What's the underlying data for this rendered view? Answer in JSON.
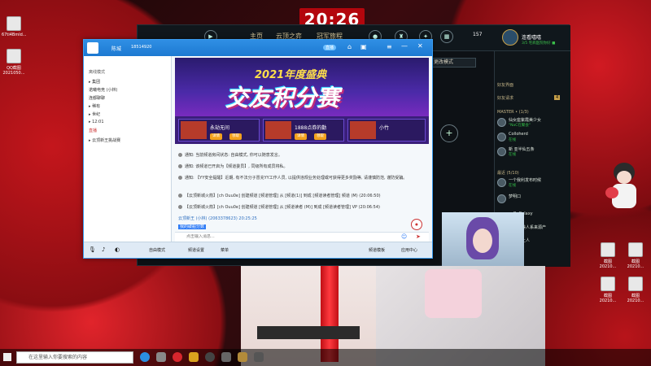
{
  "desktop": {
    "icons": [
      {
        "label": "67ti4Bmld..."
      },
      {
        "label": "QQ截图 2021050..."
      },
      {
        "label": "截图 20210..."
      },
      {
        "label": "截图 20210..."
      },
      {
        "label": "截图 20210..."
      },
      {
        "label": "截图 20210..."
      }
    ],
    "clock": "20:26"
  },
  "game": {
    "nav": [
      "主页",
      "云顶之弈",
      "冠军旅程"
    ],
    "currency": "157",
    "mode_select": "更改模式",
    "profile_name": "连看嘻嘻",
    "profile_status": "3/5 宅病医院你好 ■",
    "level": "574",
    "friend_panel_title": "好友界面",
    "requests_label": "好友请求",
    "requests_count": "4",
    "master_group": "MASTER • (1/3)",
    "recent_group": "最近 (5/10)",
    "friends": [
      {
        "name": "仙女座紫霞美少女",
        "status": "\"NaC在聚会\""
      },
      {
        "name": "Colloherd",
        "status": "在线"
      },
      {
        "name": "新 亚半仙五条",
        "status": "在线"
      },
      {
        "name": "一个我利发布时候",
        "status": "在线"
      },
      {
        "name": "梦明口",
        "status": ""
      },
      {
        "name": "ReGalaxy",
        "status": ""
      },
      {
        "name": "阿那美人系来源产",
        "status": ""
      },
      {
        "name": "冥天上人",
        "status": ""
      }
    ],
    "online_button": "在线模式"
  },
  "qq": {
    "title_name": "陈城",
    "title_id": "18514920",
    "left_header": "离线模式",
    "left_items": [
      {
        "label": "▸ 集团"
      },
      {
        "label": "    诺曦电竞 (小林)"
      },
      {
        "label": "    连都聊聊"
      },
      {
        "label": "▸ 稀有"
      },
      {
        "label": "▸ 世纪"
      },
      {
        "label": "▸ 12:01"
      },
      {
        "label": "    直播"
      },
      {
        "label": "▸ 云顶新王挑战赛"
      }
    ],
    "banner_year": "2021年度盛典",
    "banner_title": "交友积分赛",
    "cards": [
      {
        "title": "永劫无间",
        "badge": "升级福利",
        "btn1": "详情",
        "btn2": "领取"
      },
      {
        "title": "1888点券的勤",
        "badge": "工资特权",
        "btn1": "详情",
        "btn2": "领取"
      },
      {
        "title": "小竹",
        "badge": "王者归来",
        "btn1": "详情",
        "btn2": "领取"
      }
    ],
    "messages": [
      "通知: 当前频道房间状态: 自由模式, 你可以随意发言。",
      "通知: 该频道已开启为【频道委员】, 同级所有成员将私。",
      "通知: 【YY安全提醒】近期, 有不法分子冒充YY工作人员, 以提供违规业务处理或可获得更多奖励等, 请谨慎防范, 谨防受骗。",
      "【云顶新城火箭】[ch Ouu0e] 创建频道 [频道管理] 从 [频道(1)] 到成 [频道读者管理] 频道 (M) (20:06:50)",
      "【云顶新城火箭】[ch Ouu0e] 创建频道 [频道管理] 从 [频道读者 (M)] 到成 [频道读者管理] VP (20:06:54)"
    ],
    "last_sender": "云顶新王 (小林) (2063378623) 20:25:25",
    "last_message": "我的破船分数",
    "input_placeholder": "点击输入消息...",
    "bottom": {
      "tool1": "自由模式",
      "tool2": "频道设置",
      "tool3": "菜单",
      "tool4": "频道模板",
      "tool5": "应用中心"
    },
    "live_badge": "直播"
  },
  "taskbar": {
    "search_placeholder": "在这里输入你要搜索的内容"
  }
}
